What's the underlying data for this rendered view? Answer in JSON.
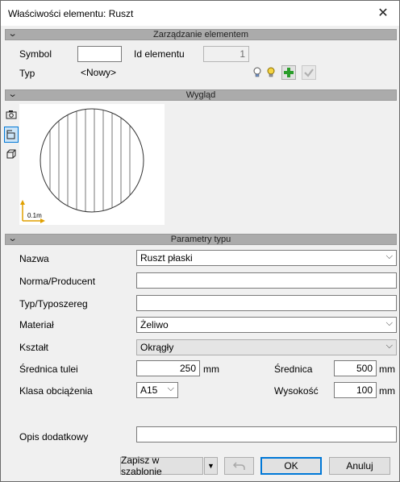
{
  "window": {
    "title": "Właściwości elementu: Ruszt",
    "close_glyph": "✕"
  },
  "sections": {
    "management": "Zarządzanie elementem",
    "appearance": "Wygląd",
    "type_params": "Parametry typu"
  },
  "management": {
    "symbol_label": "Symbol",
    "symbol_value": "",
    "id_label": "Id elementu",
    "id_value": "1",
    "type_label": "Typ",
    "type_value": "<Nowy>"
  },
  "preview": {
    "scale_label": "0.1m"
  },
  "params": {
    "name_label": "Nazwa",
    "name_value": "Ruszt płaski",
    "norm_label": "Norma/Producent",
    "norm_value": "",
    "series_label": "Typ/Typoszereg",
    "series_value": "",
    "material_label": "Materiał",
    "material_value": "Żeliwo",
    "shape_label": "Kształt",
    "shape_value": "Okrągły",
    "sleeve_label": "Średnica tulei",
    "sleeve_value": "250",
    "sleeve_unit": "mm",
    "diameter_label": "Średnica",
    "diameter_value": "500",
    "diameter_unit": "mm",
    "load_label": "Klasa obciążenia",
    "load_value": "A15",
    "height_label": "Wysokość",
    "height_value": "100",
    "height_unit": "mm",
    "desc_label": "Opis dodatkowy",
    "desc_value": ""
  },
  "footer": {
    "save_template": "Zapisz w szablonie",
    "ok": "OK",
    "cancel": "Anuluj"
  },
  "colors": {
    "section_bar": "#ababab",
    "accent": "#0078d7",
    "add_green": "#2a9d2a"
  }
}
